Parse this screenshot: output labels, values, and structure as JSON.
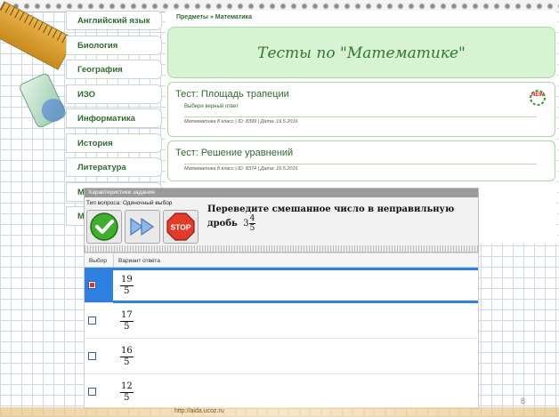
{
  "menu": {
    "items": [
      {
        "label": "Английский язык"
      },
      {
        "label": "Биология"
      },
      {
        "label": "География"
      },
      {
        "label": "ИЗО"
      },
      {
        "label": "Информатика"
      },
      {
        "label": "История"
      },
      {
        "label": "Литература"
      },
      {
        "label": "М"
      },
      {
        "label": "М"
      }
    ]
  },
  "breadcrumb": "Предметы » Математика",
  "header": {
    "title": "Тесты по \"Математике\""
  },
  "tests": [
    {
      "title": "Тест: Площадь трапеции",
      "description": "Выбери верный ответ",
      "meta": "Математика 8 класс | ID: 8399 | Дата: 19.5.2016",
      "badge": "NEW"
    },
    {
      "title": "Тест: Решение уравнений",
      "description": "",
      "meta": "Математика 8 класс | ID: 8374 | Дата: 16.5.2016"
    }
  ],
  "dialog": {
    "title": "Характеристики задания",
    "question_type": "Тип вопроса: Одиночный выбор",
    "buttons": {
      "ok": "ok-check",
      "next": "next-arrows",
      "stop": "STOP"
    },
    "question": "Переведите смешанное число в неправильную дробь",
    "mixed": {
      "whole": "3",
      "num": "4",
      "den": "5"
    }
  },
  "answers": {
    "headers": {
      "select": "Выбор",
      "variant": "Вариант ответа"
    },
    "rows": [
      {
        "num": "19",
        "den": "5",
        "selected": true
      },
      {
        "num": "17",
        "den": "5",
        "selected": false
      },
      {
        "num": "16",
        "den": "5",
        "selected": false
      },
      {
        "num": "12",
        "den": "5",
        "selected": false
      }
    ]
  },
  "page_number": "8",
  "footer_url": "http://aida.ucoz.ru",
  "colors": {
    "accent": "#2f7fe0",
    "green_text": "#2f6b2f",
    "header_bg": "#d7f3d3"
  }
}
